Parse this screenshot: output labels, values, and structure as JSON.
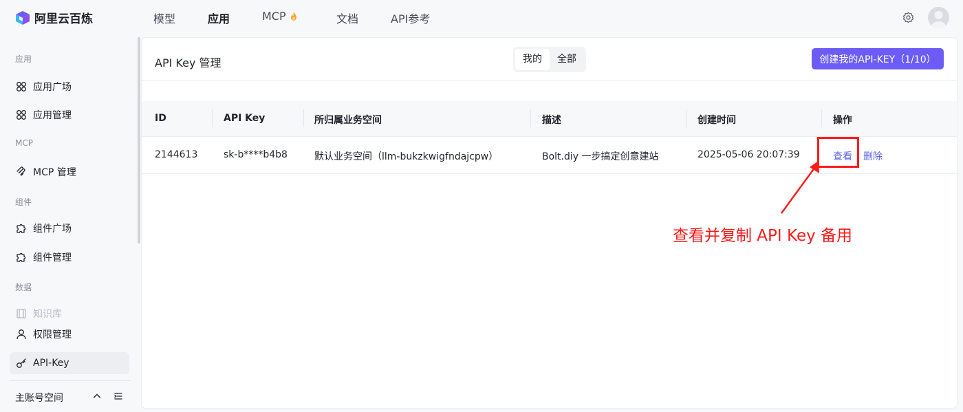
{
  "app": {
    "name": "阿里云百炼"
  },
  "topnav": {
    "items": [
      {
        "label": "模型",
        "active": false
      },
      {
        "label": "应用",
        "active": true
      },
      {
        "label": "MCP",
        "active": false,
        "icon": "fire-icon"
      },
      {
        "label": "文档",
        "active": false
      },
      {
        "label": "API参考",
        "active": false
      }
    ]
  },
  "sidebar": {
    "groups": [
      {
        "title": "应用",
        "items": [
          {
            "label": "应用广场",
            "icon": "grid-icon"
          },
          {
            "label": "应用管理",
            "icon": "grid-icon"
          }
        ]
      },
      {
        "title": "MCP",
        "items": [
          {
            "label": "MCP 管理",
            "icon": "mcp-icon"
          }
        ]
      },
      {
        "title": "组件",
        "items": [
          {
            "label": "组件广场",
            "icon": "puzzle-icon"
          },
          {
            "label": "组件管理",
            "icon": "puzzle-icon"
          }
        ]
      },
      {
        "title": "数据",
        "items": [
          {
            "label": "知识库",
            "icon": "book-icon",
            "disabled": true
          },
          {
            "label": "权限管理",
            "icon": "user-icon"
          },
          {
            "label": "API-Key",
            "icon": "key-icon",
            "active": true
          }
        ]
      }
    ],
    "footer": {
      "label": "主账号空间"
    }
  },
  "page": {
    "title": "API Key 管理",
    "filter": {
      "options": [
        "我的",
        "全部"
      ],
      "selected": "我的"
    },
    "create_button": "创建我的API-KEY（1/10）"
  },
  "table": {
    "columns": [
      "ID",
      "API Key",
      "所归属业务空间",
      "描述",
      "创建时间",
      "操作"
    ],
    "rows": [
      {
        "id": "2144613",
        "api_key": "sk-b****b4b8",
        "workspace": "默认业务空间（llm-bukzkwigfndajcpw）",
        "description": "Bolt.diy 一步搞定创意建站",
        "created": "2025-05-06 20:07:39",
        "actions": [
          "查看",
          "删除"
        ]
      }
    ]
  },
  "annotation": {
    "text": "查看并复制 API Key 备用",
    "color": "#f51a1a"
  },
  "colors": {
    "accent": "#6b5cf6",
    "link": "#5b63e6",
    "annotation": "#ff1a1a"
  }
}
